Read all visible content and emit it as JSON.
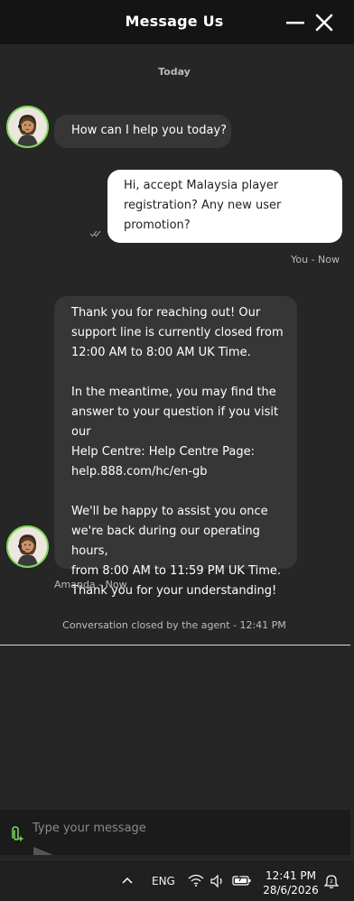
{
  "header": {
    "title": "Message Us"
  },
  "date_separator": "Today",
  "messages": [
    {
      "sender": "agent",
      "lines": [
        "How can I help you today?"
      ]
    },
    {
      "sender": "user",
      "lines": [
        "Hi, accept Malaysia player",
        "registration? Any new user",
        "promotion?"
      ],
      "meta": "You - Now"
    },
    {
      "sender": "agent",
      "lines": [
        "Thank you for reaching out! Our",
        "support line is currently closed from",
        "12:00 AM to 8:00 AM UK Time.",
        "",
        "In the meantime, you may find the",
        "answer to your question if you visit our",
        "Help Centre: Help Centre Page:",
        "help.888.com/hc/en-gb",
        "",
        "We'll be happy to assist you once",
        "we're back during our operating hours,",
        "from 8:00 AM to 11:59 PM UK Time.",
        "Thank you for your understanding!"
      ],
      "meta": "Amanda - Now"
    }
  ],
  "closed_note": "Conversation closed by the agent  - 12:41 PM",
  "composer": {
    "placeholder": "Type your message"
  },
  "taskbar": {
    "language": "ENG",
    "time": "12:41 PM",
    "date": "28/6/2026"
  },
  "colors": {
    "accent_green": "#7ed957",
    "header_bg": "#141414",
    "agent_bubble": "#363636",
    "user_bubble": "#ffffff"
  },
  "icons": [
    "minimize-icon",
    "close-icon",
    "read-check-icon",
    "attach-icon",
    "chevron-up-icon",
    "wifi-icon",
    "speaker-icon",
    "battery-icon",
    "notification-icon",
    "agent-avatar"
  ]
}
